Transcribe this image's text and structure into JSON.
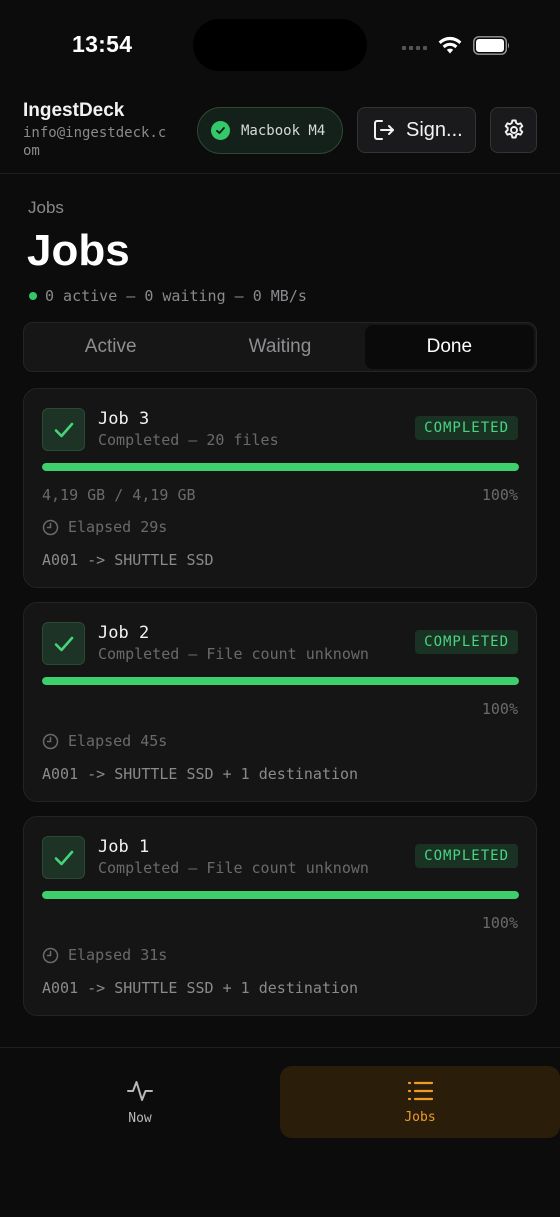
{
  "status_bar": {
    "time": "13:54"
  },
  "header": {
    "app_name": "IngestDeck",
    "email": "info@ingestdeck.com",
    "device": "Macbook M4",
    "sign_label": "Sign..."
  },
  "page": {
    "breadcrumb": "Jobs",
    "title": "Jobs",
    "stats": "0 active – 0 waiting – 0 MB/s"
  },
  "segments": [
    {
      "label": "Active",
      "selected": false
    },
    {
      "label": "Waiting",
      "selected": false
    },
    {
      "label": "Done",
      "selected": true
    }
  ],
  "jobs": [
    {
      "title": "Job 3",
      "subtitle": "Completed – 20 files",
      "badge": "COMPLETED",
      "progress": 1.0,
      "size": "4,19 GB / 4,19 GB",
      "percent": "100%",
      "elapsed": "Elapsed 29s",
      "route": "A001 -> SHUTTLE SSD"
    },
    {
      "title": "Job 2",
      "subtitle": "Completed – File count unknown",
      "badge": "COMPLETED",
      "progress": 1.0,
      "size": "",
      "percent": "100%",
      "elapsed": "Elapsed 45s",
      "route": "A001 -> SHUTTLE SSD + 1 destination"
    },
    {
      "title": "Job 1",
      "subtitle": "Completed – File count unknown",
      "badge": "COMPLETED",
      "progress": 1.0,
      "size": "",
      "percent": "100%",
      "elapsed": "Elapsed 31s",
      "route": "A001 -> SHUTTLE SSD + 1 destination"
    }
  ],
  "tabs": [
    {
      "label": "Now",
      "icon": "activity-icon"
    },
    {
      "label": "Jobs",
      "icon": "list-icon",
      "active": true
    }
  ],
  "colors": {
    "accent": "#f09a27",
    "success": "#3dd06d",
    "background": "#0c0c0d"
  }
}
